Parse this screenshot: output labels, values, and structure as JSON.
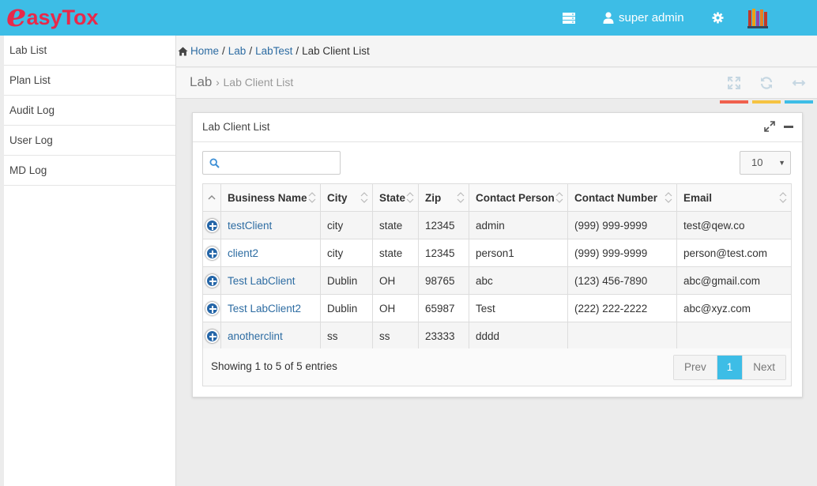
{
  "app": {
    "logo_e": "e",
    "logo_rest": "asyTox"
  },
  "topbar": {
    "user_name": "super admin"
  },
  "sidebar": {
    "items": [
      {
        "label": "Lab List"
      },
      {
        "label": "Plan List"
      },
      {
        "label": "Audit Log"
      },
      {
        "label": "User Log"
      },
      {
        "label": "MD Log"
      }
    ]
  },
  "breadcrumb": {
    "items": [
      "Home",
      "Lab",
      "LabTest"
    ],
    "separator": "/",
    "current": "Lab Client List"
  },
  "page_header": {
    "title": "Lab",
    "subtitle": "Lab Client List",
    "arrow": "›"
  },
  "panel": {
    "title": "Lab Client List",
    "search": {
      "placeholder": "",
      "value": ""
    },
    "page_length": "10",
    "columns": [
      "Business Name",
      "City",
      "State",
      "Zip",
      "Contact Person",
      "Contact Number",
      "Email"
    ],
    "rows": [
      [
        "testClient",
        "city",
        "state",
        "12345",
        "admin",
        "(999) 999-9999",
        "test@qew.co"
      ],
      [
        "client2",
        "city",
        "state",
        "12345",
        "person1",
        "(999) 999-9999",
        "person@test.com"
      ],
      [
        "Test LabClient",
        "Dublin",
        "OH",
        "98765",
        "abc",
        "(123) 456-7890",
        "abc@gmail.com"
      ],
      [
        "Test LabClient2",
        "Dublin",
        "OH",
        "65987",
        "Test",
        "(222) 222-2222",
        "abc@xyz.com"
      ],
      [
        "anotherclint",
        "ss",
        "ss",
        "23333",
        "dddd",
        "",
        ""
      ]
    ],
    "info": "Showing 1 to 5 of 5 entries",
    "pager": {
      "prev": "Prev",
      "current": "1",
      "next": "Next"
    }
  },
  "colors": {
    "topbar": "#3dbde6",
    "logo": "#e8294a",
    "link": "#2d6ca2",
    "bar_red": "#f0604d",
    "bar_yellow": "#f5c342",
    "bar_blue": "#3dbde6"
  },
  "icons": [
    "server-icon",
    "user-icon",
    "gear-icon",
    "books-icon",
    "home-icon",
    "expand-icon",
    "refresh-icon",
    "arrows-horizontal-icon",
    "fullscreen-icon",
    "minimize-icon",
    "search-icon",
    "sort-icon",
    "plus-circle-icon"
  ]
}
